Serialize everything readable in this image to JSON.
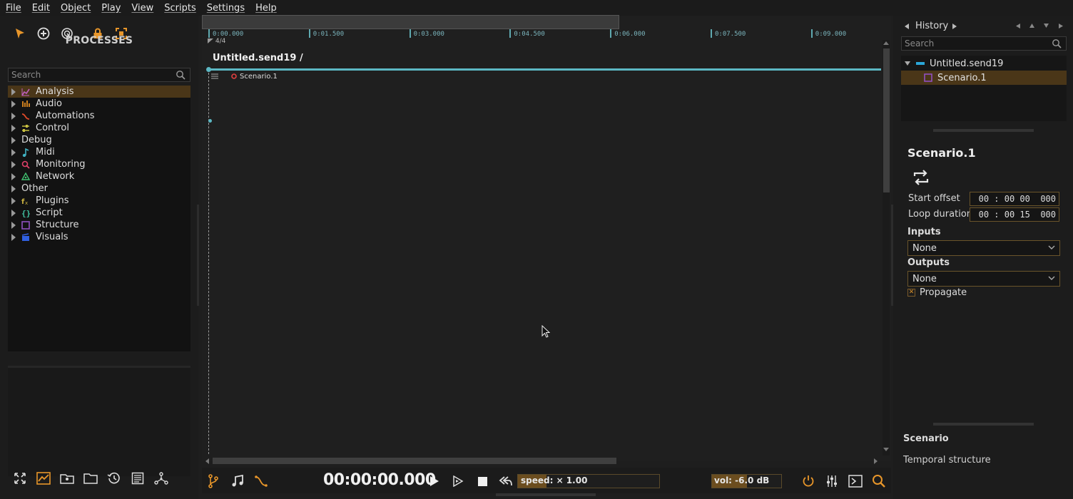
{
  "menu": [
    "File",
    "Edit",
    "Object",
    "Play",
    "View",
    "Scripts",
    "Settings",
    "Help"
  ],
  "processes": {
    "title": "PROCESSES",
    "search_placeholder": "Search",
    "items": [
      {
        "label": "Analysis",
        "icon": "chart-line-icon",
        "color": "#c060c0",
        "selected": true
      },
      {
        "label": "Audio",
        "icon": "audio-bars-icon",
        "color": "#e08a20"
      },
      {
        "label": "Automations",
        "icon": "automation-curve-icon",
        "color": "#e04a2a"
      },
      {
        "label": "Control",
        "icon": "sliders-icon",
        "color": "#c8c040"
      },
      {
        "label": "Debug",
        "icon": "",
        "color": ""
      },
      {
        "label": "Midi",
        "icon": "music-note-icon",
        "color": "#40b0c0"
      },
      {
        "label": "Monitoring",
        "icon": "magnifier-icon",
        "color": "#e0406a"
      },
      {
        "label": "Network",
        "icon": "network-icon",
        "color": "#40c070"
      },
      {
        "label": "Other",
        "icon": "",
        "color": ""
      },
      {
        "label": "Plugins",
        "icon": "fx-icon",
        "color": "#c8b040"
      },
      {
        "label": "Script",
        "icon": "braces-icon",
        "color": "#40c0a0"
      },
      {
        "label": "Structure",
        "icon": "square-icon",
        "color": "#9050c0"
      },
      {
        "label": "Visuals",
        "icon": "clapper-icon",
        "color": "#3060e0"
      }
    ]
  },
  "timeline": {
    "ticks": [
      "0:00.000",
      "0:01.500",
      "0:03.000",
      "0:04.500",
      "0:06.000",
      "0:07.500",
      "0:09.000"
    ],
    "time_signature": "4/4",
    "breadcrumb": "Untitled.send19 /",
    "scenario_label": "Scenario.1"
  },
  "transport": {
    "time": "00:00:00.000",
    "speed": "speed: × 1.00",
    "speed_level": 0.2,
    "volume": "vol: -6.0 dB",
    "volume_level": 0.5
  },
  "history": {
    "label": "History",
    "search_placeholder": "Search",
    "tree": [
      {
        "label": "Untitled.send19",
        "depth": 0,
        "selected": false
      },
      {
        "label": "Scenario.1",
        "depth": 1,
        "selected": true
      }
    ]
  },
  "inspector": {
    "title": "Scenario.1",
    "start_offset_label": "Start offset",
    "start_offset_value": "00 : 00 00  000",
    "loop_duration_label": "Loop duration",
    "loop_duration_value": "00 : 00 15  000",
    "inputs_label": "Inputs",
    "inputs_value": "None",
    "outputs_label": "Outputs",
    "outputs_value": "None",
    "propagate_label": "Propagate",
    "propagate_checked": true
  },
  "info": {
    "title": "Scenario",
    "description": "Temporal structure"
  },
  "colors": {
    "accent": "#e8962a",
    "timeline": "#5cb8c4",
    "selection": "#4a3618"
  }
}
